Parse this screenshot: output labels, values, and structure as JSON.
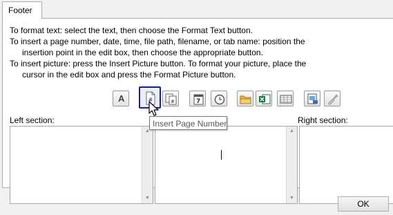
{
  "tab": {
    "label": "Footer"
  },
  "instructions": [
    "To format text:  select the text, then choose the Format Text button.",
    "To insert a page number, date, time, file path, filename, or tab name:  position the",
    "insertion point in the edit box, then choose the appropriate button.",
    "To insert picture: press the Insert Picture button.  To format your picture, place the",
    "cursor in the edit box and press the Format Picture button."
  ],
  "toolbar": {
    "format_text_glyph": "A",
    "insert_date_glyph": "7",
    "buttons": [
      {
        "name": "format-text-icon"
      },
      {
        "name": "insert-page-number-icon",
        "highlighted": true
      },
      {
        "name": "insert-number-of-pages-icon"
      },
      {
        "name": "insert-date-icon"
      },
      {
        "name": "insert-time-icon"
      },
      {
        "name": "insert-file-path-icon"
      },
      {
        "name": "insert-file-name-icon"
      },
      {
        "name": "insert-sheet-name-icon"
      },
      {
        "name": "insert-picture-icon"
      },
      {
        "name": "format-picture-icon"
      }
    ]
  },
  "sections": {
    "left_label": "Left section:",
    "right_label": "Right section:"
  },
  "tooltip": "Insert Page Number",
  "footer": {
    "ok_label": "OK"
  },
  "colors": {
    "highlight_border": "#1a1aa8",
    "excel_green": "#1e7145",
    "folder_yellow": "#e8b84a"
  }
}
